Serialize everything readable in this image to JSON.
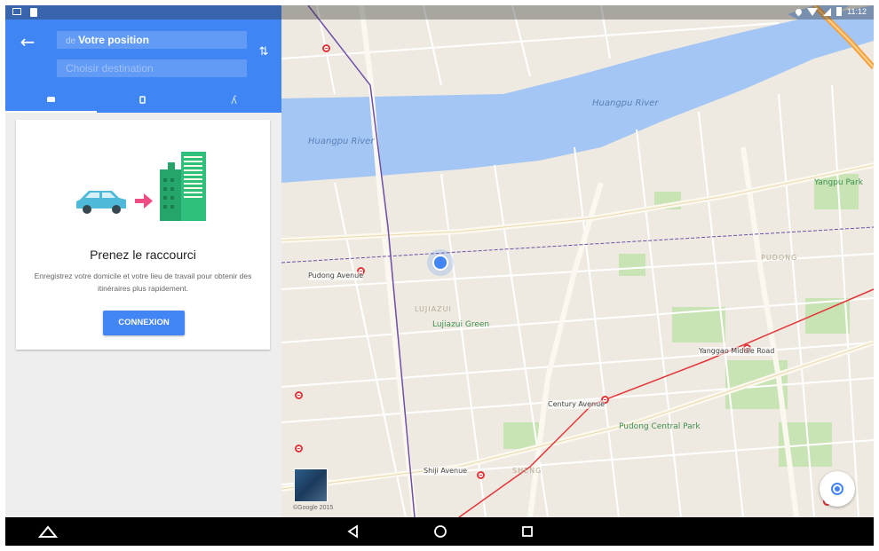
{
  "route": {
    "origin_prefix": "de",
    "origin": "Votre position",
    "destination_placeholder": "Choisir destination",
    "modes": [
      "car-icon",
      "transit-icon",
      "walk-icon"
    ]
  },
  "promo": {
    "title": "Prenez le raccourci",
    "text": "Enregistrez votre domicile et votre lieu de travail pour obtenir des itinéraires plus rapidement.",
    "button": "CONNEXION"
  },
  "map": {
    "water_labels": [
      "Huangpu River",
      "Huangpu River"
    ],
    "district_labels": [
      "LUJIAZUI",
      "PUDONG",
      "SHENG"
    ],
    "metro_stations": [
      "Pudong Avenue",
      "Yanggao Middle Road",
      "Century Avenue",
      "Shiji Avenue"
    ],
    "parks": [
      "Yangpu Park",
      "Pudong Central Park",
      "Lujiazui Green"
    ],
    "credit": "©Google 2015"
  },
  "status_bar": {
    "time": "11:12"
  },
  "colors": {
    "accent": "#3f85f4",
    "map_water": "#a4c6f4",
    "map_land": "#efeae1",
    "metro": "#e2363a"
  }
}
